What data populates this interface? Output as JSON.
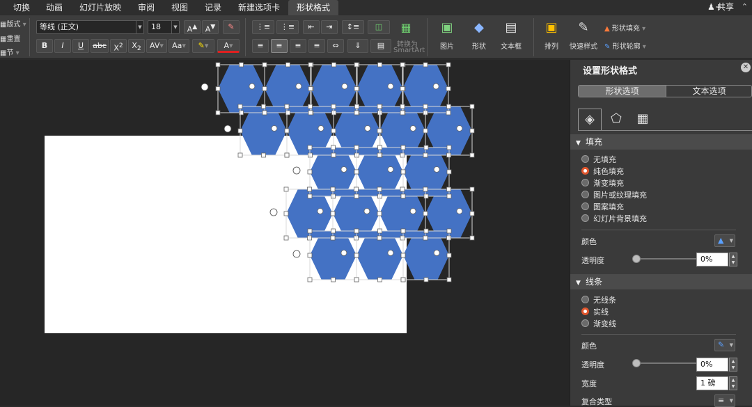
{
  "tabs": [
    {
      "label": "切换"
    },
    {
      "label": "动画"
    },
    {
      "label": "幻灯片放映"
    },
    {
      "label": "审阅"
    },
    {
      "label": "视图"
    },
    {
      "label": "记录"
    },
    {
      "label": "新建选项卡"
    },
    {
      "label": "形状格式"
    }
  ],
  "share_label": "共享",
  "ribbon": {
    "layout_label": "版式",
    "reset_label": "重置",
    "section_label": "节",
    "font_name": "等线 (正文)",
    "font_size": "18",
    "increase_font": "A",
    "decrease_font": "A",
    "bold": "B",
    "italic": "I",
    "underline": "U",
    "strikethrough": "abc",
    "superscript": "X",
    "subscript": "X",
    "char_spacing": "AV",
    "change_case": "Aa",
    "font_color": "A",
    "convert_label_1": "转换为",
    "convert_label_2": "SmartArt",
    "picture_label": "图片",
    "shape_label": "形状",
    "textbox_label": "文本框",
    "arrange_label": "排列",
    "quick_style_label": "快速样式",
    "shape_fill_label": "形状填充",
    "shape_outline_label": "形状轮廓"
  },
  "pane": {
    "title": "设置形状格式",
    "seg_shape": "形状选项",
    "seg_text": "文本选项",
    "fill_section": "填充",
    "fill_options": [
      "无填充",
      "纯色填充",
      "渐变填充",
      "图片或纹理填充",
      "图案填充",
      "幻灯片背景填充"
    ],
    "fill_selected": 1,
    "fill_color_label": "颜色",
    "fill_transparency_label": "透明度",
    "fill_transparency_value": "0%",
    "line_section": "线条",
    "line_options": [
      "无线条",
      "实线",
      "渐变线"
    ],
    "line_selected": 1,
    "line_color_label": "颜色",
    "line_transparency_label": "透明度",
    "line_transparency_value": "0%",
    "width_label": "宽度",
    "width_value": "1 磅",
    "compound_label": "复合类型"
  },
  "colors": {
    "hex_fill": "#4472c4",
    "accent_radio": "#e0552c"
  }
}
